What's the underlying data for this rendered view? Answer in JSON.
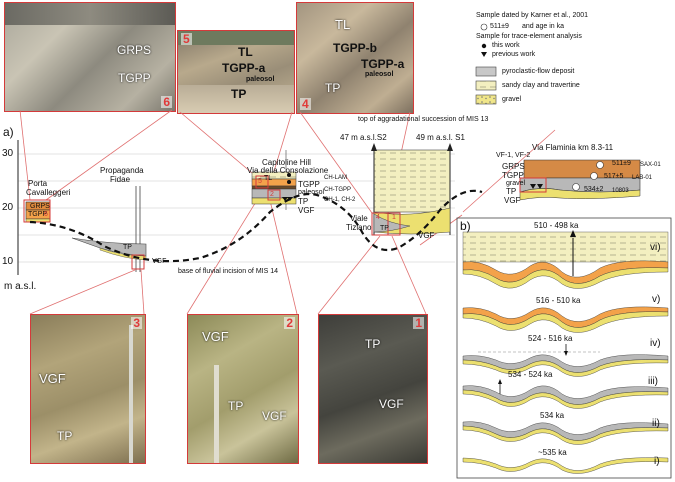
{
  "photos": {
    "p6": {
      "num": "6",
      "labels": [
        "GRPS",
        "TGPP"
      ]
    },
    "p5": {
      "num": "5",
      "labels": [
        "TL",
        "TGPP-a",
        "paleosol",
        "TP"
      ]
    },
    "p4": {
      "num": "4",
      "labels": [
        "TL",
        "TGPP-b",
        "TGPP-a",
        "paleosol",
        "TP"
      ]
    },
    "p3": {
      "num": "3",
      "labels": [
        "VGF",
        "TP"
      ]
    },
    "p2": {
      "num": "2",
      "labels": [
        "VGF",
        "TP",
        "VGF"
      ]
    },
    "p1": {
      "num": "1",
      "labels": [
        "TP",
        "VGF"
      ]
    }
  },
  "legend": {
    "sample_dated": "Sample dated by Karner et al., 2001",
    "age_example": "511±9",
    "age_text": "and age in ka",
    "trace_title": "Sample for trace-element analysis",
    "this_work": "this work",
    "previous_work": "previous work",
    "pyroclastic": "pyroclastic-flow deposit",
    "sandy_clay": "sandy clay and  travertine",
    "gravel": "gravel"
  },
  "section_a": {
    "panel_label": "a)",
    "y_ticks": [
      "30",
      "20",
      "10"
    ],
    "unit": "m a.s.l.",
    "top_aggradation": "top of aggradational succession of MIS 13",
    "base_incision": "base of fluvial incision of MIS 14",
    "s2": "47 m a.s.l.S2",
    "s1": "49 m a.s.l. S1",
    "porta": [
      "Porta",
      "Cavalleggeri"
    ],
    "propaganda": [
      "Propaganda",
      "Fidae"
    ],
    "capitoline": [
      "Capitoline Hill",
      "Via della Consolazione"
    ],
    "viale": [
      "Viale",
      "Tiziano"
    ],
    "flaminia": "Via Flaminia km 8.3-11",
    "cap_units": [
      "TL",
      "TGPP",
      "paleosol",
      "TP",
      "VGF"
    ],
    "cap_samples": [
      "CH-LAM",
      "CH-TGPP",
      "CH-1, CH-2"
    ],
    "fla_units": [
      "GRPS",
      "TGPP",
      "gravel",
      "TP",
      "VGF"
    ],
    "fla_vf": "VF-1, VF-2",
    "fla_ages": [
      "511±9",
      "517±5",
      "534±2"
    ],
    "fla_samples": [
      "SAX-01",
      "LAB-01",
      "10803"
    ],
    "porta_units": [
      "GRPS",
      "TGPP",
      "6"
    ],
    "prop_units": [
      "TP",
      "VGF"
    ],
    "viale_units": [
      "TP",
      "VGF"
    ],
    "viale_nums": [
      "4",
      "1"
    ],
    "cap_nums": [
      "5",
      "2"
    ]
  },
  "section_b": {
    "panel_label": "b)",
    "stages": [
      {
        "age": "510 - 498 ka",
        "roman": "vi)"
      },
      {
        "age": "516 - 510 ka",
        "roman": "v)"
      },
      {
        "age": "524 - 516 ka",
        "roman": "iv)"
      },
      {
        "age": "534 - 524 ka",
        "roman": "iii)"
      },
      {
        "age": "534 ka",
        "roman": "ii)"
      },
      {
        "age": "~535 ka",
        "roman": "i)"
      }
    ]
  }
}
